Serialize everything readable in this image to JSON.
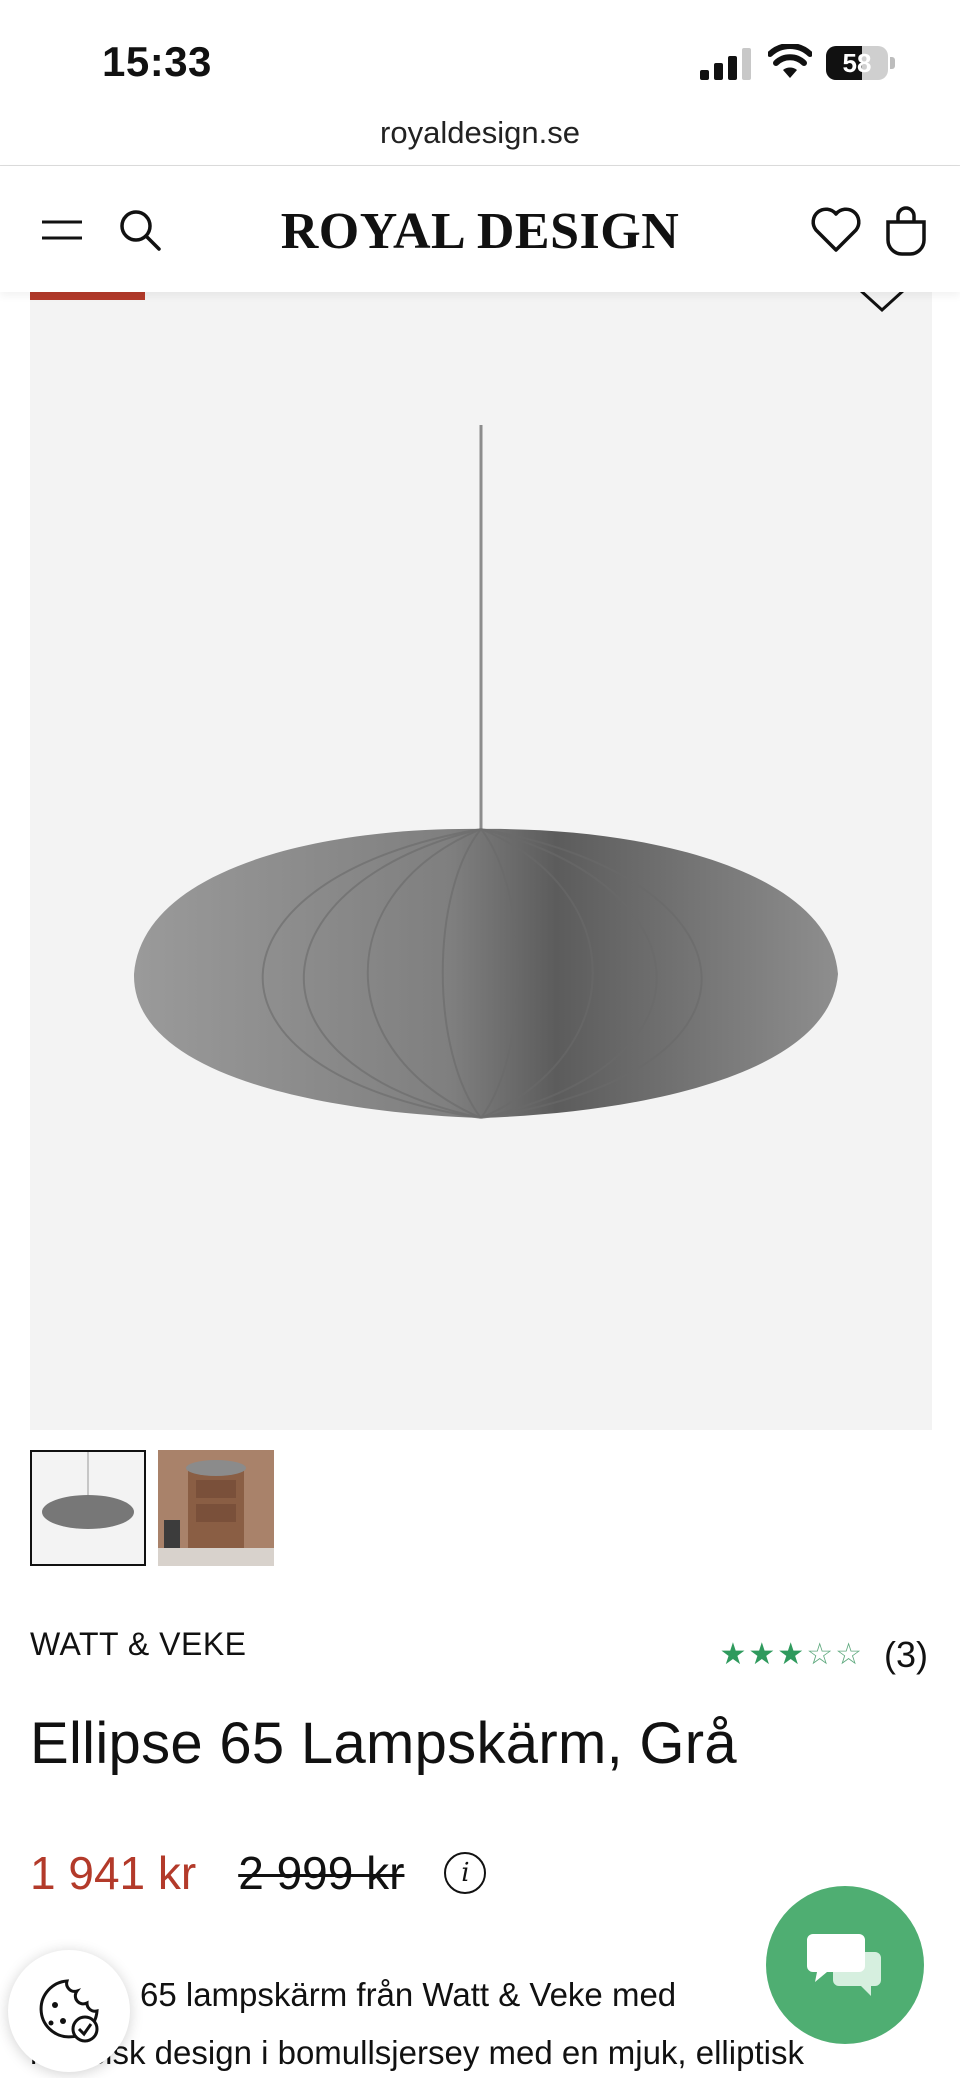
{
  "status_bar": {
    "time": "15:33",
    "battery": "58",
    "battery_level": 0.58
  },
  "browser": {
    "url": "royaldesign.se"
  },
  "header": {
    "logo": "ROYAL DESIGN",
    "icons": [
      "menu-icon",
      "search-icon",
      "heart-icon",
      "bag-icon"
    ]
  },
  "product": {
    "brand": "WATT & VEKE",
    "rating": {
      "stars_filled": 3,
      "stars_total": 5,
      "count": "(3)"
    },
    "title": "Ellipse 65 Lampskärm, Grå",
    "price_now": "1 941 kr",
    "price_old": "2 999 kr",
    "description_line1": "65 lampskärm från Watt & Veke med",
    "description_line2": "klassisk design i bomullsjersey med en mjuk, elliptisk"
  },
  "thumbnails": [
    "lamp-grey",
    "lamp-room"
  ],
  "colors": {
    "sale_red": "#b33a2a",
    "star_green": "#2f9a5d",
    "chat_green": "#4fae72"
  }
}
